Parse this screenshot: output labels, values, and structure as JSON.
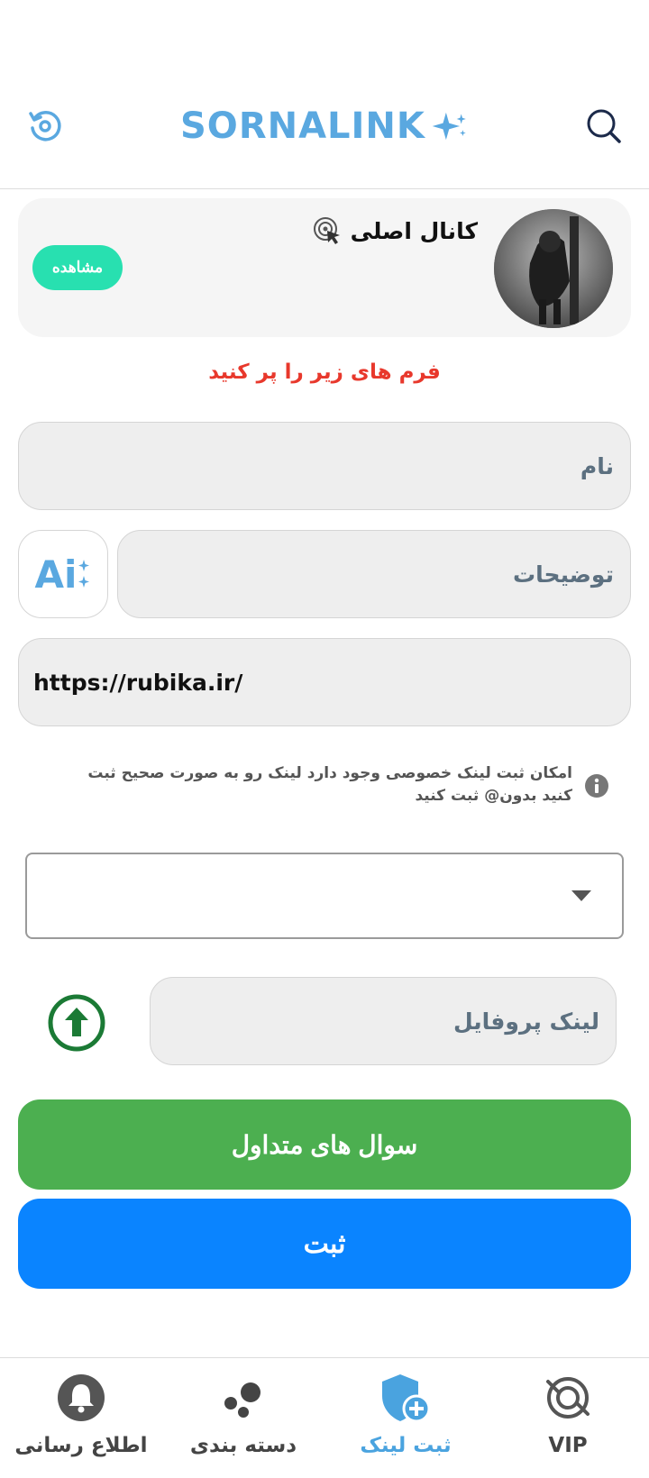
{
  "header": {
    "brand": "SORNALINK"
  },
  "channel": {
    "title": "کانال اصلی",
    "view_label": "مشاهده"
  },
  "form": {
    "instruction": "فرم های زیر را پر کنید",
    "name_placeholder": "نام",
    "description_placeholder": "توضیحات",
    "ai_label": "Ai",
    "link_value": "https://rubika.ir/",
    "note": "امکان ثبت لینک خصوصی وجود دارد لینک رو به صورت صحیح ثبت کنید بدون@ ثبت کنید",
    "profile_link_placeholder": "لینک پروفایل",
    "faq_label": "سوال های متداول",
    "submit_label": "ثبت"
  },
  "bottom_nav": {
    "items": [
      {
        "label": "اطلاع رسانی",
        "icon": "bell-icon"
      },
      {
        "label": "دسته بندی",
        "icon": "category-dots-icon"
      },
      {
        "label": "ثبت لینک",
        "icon": "shield-plus-icon",
        "active": true
      },
      {
        "label": "VIP",
        "icon": "vip-target-icon"
      }
    ]
  },
  "colors": {
    "brand": "#5aa8e0",
    "accent_green": "#4caf50",
    "accent_blue": "#0a84ff",
    "teal": "#28e0b0",
    "error": "#e8382c"
  }
}
